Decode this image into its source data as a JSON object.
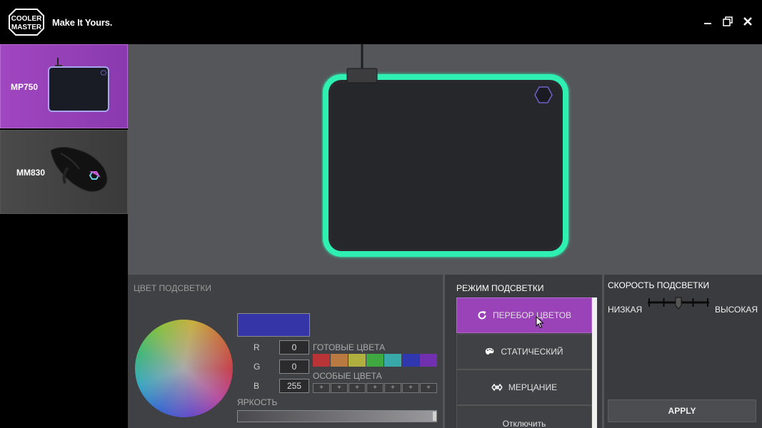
{
  "app": {
    "logo_text": "COOLER MASTER",
    "slogan": "Make It Yours."
  },
  "window_controls": [
    "minimize-icon",
    "restore-icon",
    "close-icon"
  ],
  "devices": [
    {
      "label": "MP750",
      "selected": true
    },
    {
      "label": "MM830",
      "selected": false
    }
  ],
  "color_panel": {
    "title": "ЦВЕТ ПОДСВЕТКИ",
    "current_color": "#3535a8",
    "r_label": "R",
    "r_value": "0",
    "g_label": "G",
    "g_value": "0",
    "b_label": "B",
    "b_value": "255",
    "presets_label": "ГОТОВЫЕ ЦВЕТА",
    "presets": [
      "#b83436",
      "#b87a40",
      "#b0b040",
      "#40a840",
      "#38a8a8",
      "#3038b0",
      "#7030b0"
    ],
    "custom_label": "ОСОБЫЕ ЦВЕТА",
    "custom_slots": [
      "+",
      "+",
      "+",
      "+",
      "+",
      "+",
      "+"
    ],
    "brightness_label": "ЯРКОСТЬ",
    "brightness": 1.0
  },
  "mode_panel": {
    "title": "РЕЖИМ ПОДСВЕТКИ",
    "modes": [
      {
        "label": "ПЕРЕБОР ЦВЕТОВ",
        "icon": "refresh-icon",
        "selected": true
      },
      {
        "label": "СТАТИЧЕСКИЙ",
        "icon": "palette-icon",
        "selected": false
      },
      {
        "label": "МЕРЦАНИЕ",
        "icon": "flicker-icon",
        "selected": false
      },
      {
        "label": "Отключить",
        "icon": "",
        "selected": false
      }
    ]
  },
  "speed_panel": {
    "title": "СКОРОСТЬ ПОДСВЕТКИ",
    "low_label": "НИЗКАЯ",
    "high_label": "ВЫСОКАЯ",
    "speed_step": 3,
    "speed_steps": 5,
    "apply_label": "APPLY"
  },
  "colors": {
    "accent": "#9a42b8",
    "pad_glow": "#2ef0b0"
  }
}
